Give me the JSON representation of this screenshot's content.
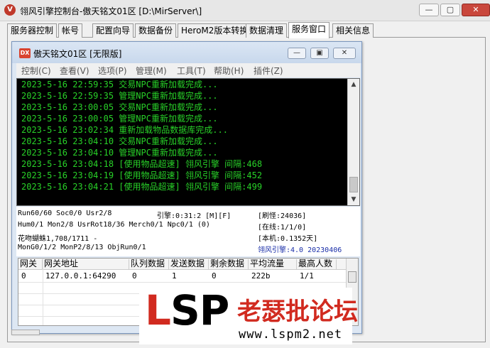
{
  "window": {
    "title": "翎风引擎控制台-傲天铭文01区 [D:\\MirServer\\]",
    "icon": "app-logo-icon",
    "minimize": "—",
    "maximize": "▢",
    "close": "✕"
  },
  "tabs": [
    {
      "label": "服务器控制",
      "active": false
    },
    {
      "label": "帐号",
      "active": false
    },
    {
      "label": "配置向导",
      "active": false
    },
    {
      "label": "数据备份",
      "active": false
    },
    {
      "label": "HeroM2版本转换",
      "active": false
    },
    {
      "label": "数据清理",
      "active": false
    },
    {
      "label": "服务窗口",
      "active": true
    },
    {
      "label": "相关信息",
      "active": false
    }
  ],
  "inner_window": {
    "icon_text": "DX",
    "title": "傲天铭文01区 [无限版]",
    "minimize": "—",
    "maximize": "▣",
    "close": "✕"
  },
  "menu": [
    "控制(C)",
    "查看(V)",
    "选项(P)",
    "管理(M)",
    "工具(T)",
    "帮助(H)",
    "插件(Z)"
  ],
  "log": [
    "2023-5-16 22:59:35 交易NPC重新加载完成...",
    "2023-5-16 22:59:35 管理NPC重新加载完成...",
    "2023-5-16 23:00:05 交易NPC重新加载完成...",
    "2023-5-16 23:00:05 管理NPC重新加载完成...",
    "2023-5-16 23:02:34 重新加载物品数据库完成...",
    "2023-5-16 23:04:10 交易NPC重新加载完成...",
    "2023-5-16 23:04:10 管理NPC重新加载完成...",
    "2023-5-16 23:04:18 [使用物品超速] 翎风引擎 间隔:468",
    "2023-5-16 23:04:19 [使用物品超速] 翎风引擎 间隔:452",
    "2023-5-16 23:04:21 [使用物品超速] 翎风引擎 间隔:499"
  ],
  "stats": {
    "line1_left": "Run60/60 Soc0/0 Usr2/8",
    "line1_mid": "引擎:0:31:2 [M][F]",
    "line1_right": "[刷怪:24036]",
    "line2_left": "Hum0/1 Mon2/8 UsrRot18/36 Merch0/1 Npc0/1 (0)",
    "line2_right": "[在线:1/1/0]",
    "line3_left": "花吻蝴蛛1,708/1711 -",
    "line3_right": "[本机:0.1352天]",
    "line4_left": "MonG0/1/2 MonP2/8/13 ObjRun0/1",
    "line4_right": "翎风引擎:4.0 20230406"
  },
  "gateway_table": {
    "headers": [
      "网关",
      "网关地址",
      "队列数据",
      "发送数据",
      "剩余数据",
      "平均流量",
      "最高人数"
    ],
    "rows": [
      [
        "0",
        "127.0.0.1:64290",
        "0",
        "1",
        "0",
        "222b",
        "1/1"
      ]
    ]
  },
  "watermark": {
    "lsp_l": "L",
    "lsp_s": "S",
    "lsp_p": "P",
    "cn": "老瑟批论坛",
    "url": "www.lspm2.net"
  },
  "colors": {
    "log_text": "#28d128",
    "log_bg": "#000000",
    "accent_red": "#d12a1f",
    "version_blue": "#1a2ea8"
  }
}
